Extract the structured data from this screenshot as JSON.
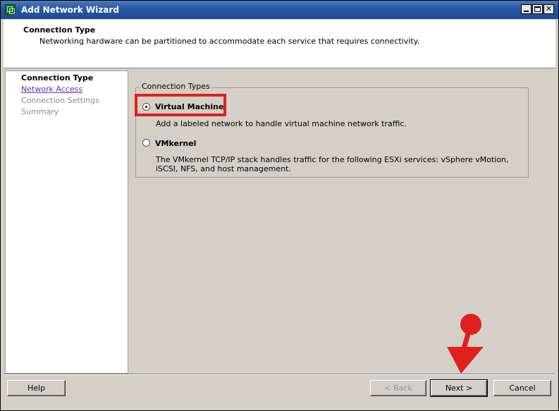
{
  "window": {
    "title": "Add Network Wizard"
  },
  "header": {
    "title": "Connection Type",
    "subtitle": "Networking hardware can be partitioned to accommodate each service that requires connectivity."
  },
  "steps": [
    {
      "label": "Connection Type",
      "state": "current"
    },
    {
      "label": "Network Access",
      "state": "link"
    },
    {
      "label": "Connection Settings",
      "state": "disabled"
    },
    {
      "label": "Summary",
      "state": "disabled"
    }
  ],
  "connection_types": {
    "legend": "Connection Types",
    "options": [
      {
        "label": "Virtual Machine",
        "selected": true,
        "description": "Add a labeled network to handle virtual machine network traffic."
      },
      {
        "label": "VMkernel",
        "selected": false,
        "description": "The VMkernel TCP/IP stack handles traffic for the following ESXi services: vSphere vMotion, iSCSI, NFS, and host management."
      }
    ]
  },
  "buttons": {
    "help": "Help",
    "back": "< Back",
    "next": "Next >",
    "cancel": "Cancel"
  },
  "colors": {
    "title_bar": "#2a5aa5",
    "annotation_red": "#e02020",
    "link_purple": "#6b2fb0"
  }
}
